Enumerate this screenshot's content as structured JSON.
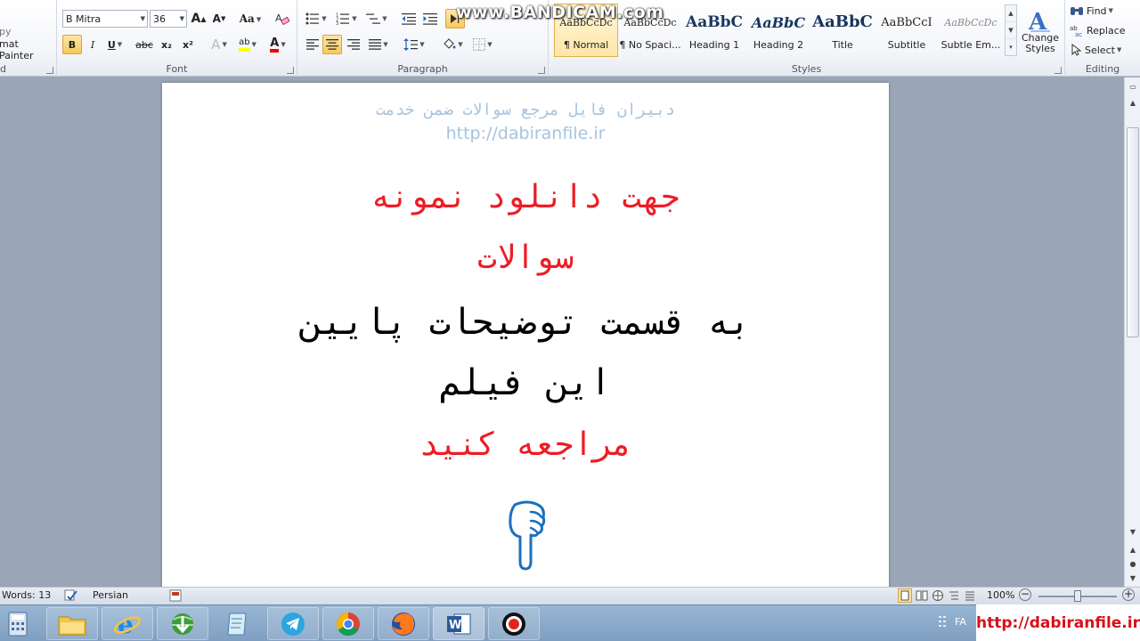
{
  "watermark": "www.BANDICAM.com",
  "ribbon": {
    "clipboard": {
      "copy_label": "py",
      "format_painter_label": "mat Painter",
      "group_label": "d"
    },
    "font": {
      "font_name": "B Mitra",
      "font_size": "36",
      "grow_glyph": "A",
      "shrink_glyph": "A",
      "case_label": "Aa",
      "bold": "B",
      "italic": "I",
      "underline": "U",
      "strike": "abc",
      "subscript": "x₂",
      "superscript": "x²",
      "effects_glyph": "A",
      "highlight_glyph": "ab",
      "font_color_glyph": "A",
      "group_label": "Font"
    },
    "paragraph": {
      "group_label": "Paragraph"
    },
    "styles": {
      "group_label": "Styles",
      "change_styles_label": "Change Styles",
      "tiles": [
        {
          "preview": "AaBbCcDc",
          "name": "¶ Normal"
        },
        {
          "preview": "AaBbCcDc",
          "name": "¶ No Spaci..."
        },
        {
          "preview": "AaBbC",
          "name": "Heading 1"
        },
        {
          "preview": "AaBbC",
          "name": "Heading 2"
        },
        {
          "preview": "AaBbC",
          "name": "Title"
        },
        {
          "preview": "AaBbCcI",
          "name": "Subtitle"
        },
        {
          "preview": "AaBbCcDc",
          "name": "Subtle Em..."
        }
      ]
    },
    "editing": {
      "group_label": "Editing",
      "find_label": "Find",
      "replace_label": "Replace",
      "select_label": "Select"
    }
  },
  "document": {
    "header_fa": "دبیران فایل مرجع سوالات ضمن خدمت",
    "header_url": "http://dabiranfile.ir",
    "line1": "جهت دانلود نمونه",
    "line2": "سوالات",
    "line3": "به قسمت توضیحات پایین",
    "line4": "این فیلم",
    "line5": "مراجعه کنید"
  },
  "status": {
    "words": "Words: 13",
    "language": "Persian",
    "zoom": "100%",
    "zoom_level": 0.5
  },
  "taskbar": {
    "lang": "FA",
    "site": "http://dabiranfile.ir"
  },
  "colors": {
    "accent_red": "#ee1c24",
    "header_blue": "#a8c3dc",
    "active_gold": "#f8c95a"
  }
}
